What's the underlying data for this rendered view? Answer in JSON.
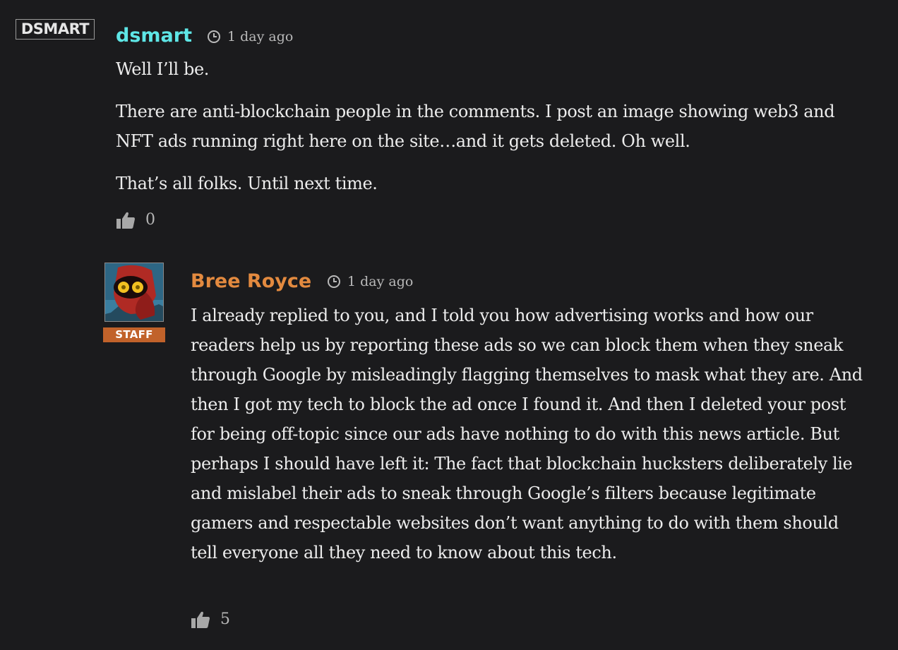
{
  "comments": [
    {
      "avatar_text": "DSMART",
      "author": "dsmart",
      "author_color": "#5ee6e6",
      "time": "1 day ago",
      "paragraphs": [
        "Well I’ll be.",
        "There are anti-blockchain people in the comments. I post an image showing web3 and NFT ads running right here on the site…and it gets deleted. Oh well.",
        "That’s all folks. Until next time."
      ],
      "likes": "0"
    },
    {
      "author": "Bree Royce",
      "author_color": "#e38a3f",
      "badge": "STAFF",
      "time": "1 day ago",
      "paragraphs": [
        "I already replied to you, and I told you how advertising works and how our readers help us by reporting these ads so we can block them when they sneak through Google by misleadingly flagging themselves to mask what they are. And then I got my tech to block the ad once I found it. And then I deleted your post for being off-topic since our ads have nothing to do with this news article. But perhaps I should have left it: The fact that blockchain hucksters deliberately lie and mislabel their ads to sneak through Google’s filters because legitimate gamers and respectable websites don’t want anything to do with them should tell everyone all they need to know about this tech."
      ],
      "likes": "5"
    }
  ]
}
